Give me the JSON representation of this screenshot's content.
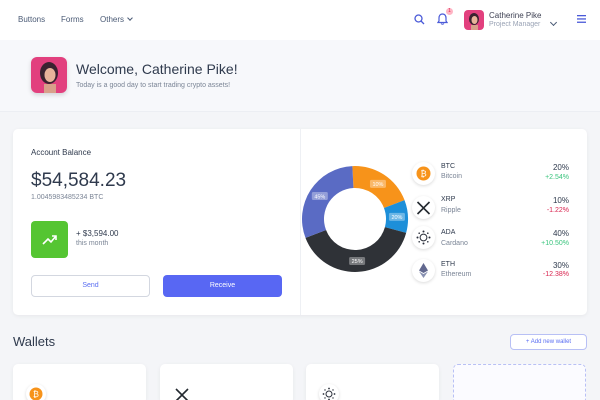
{
  "nav": {
    "links": [
      "Buttons",
      "Forms",
      "Others"
    ],
    "notification_count": "1",
    "user": {
      "name": "Catherine Pike",
      "role": "Project Manager"
    }
  },
  "welcome": {
    "title": "Welcome, Catherine Pike!",
    "subtitle": "Today is a good day to start trading crypto assets!"
  },
  "account": {
    "title": "Account Balance",
    "amount": "$54,584.23",
    "btc": "1.0045983485234 BTC",
    "change_amount": "+ $3,594.00",
    "change_period": "this month",
    "send_label": "Send",
    "receive_label": "Receive"
  },
  "chart_data": {
    "type": "pie",
    "categories": [
      "BTC",
      "XRP",
      "ADA",
      "ETH"
    ],
    "values": [
      20,
      10,
      40,
      30
    ],
    "colors": [
      "#f7931a",
      "#1d8fd9",
      "#2f3237",
      "#5a6bc4"
    ],
    "donut_labels": [
      "10%",
      "20%",
      "25%",
      "45%"
    ]
  },
  "assets": [
    {
      "symbol": "BTC",
      "name": "Bitcoin",
      "percent": "20%",
      "change": "+2.54%",
      "direction": "up",
      "icon": "bitcoin-icon"
    },
    {
      "symbol": "XRP",
      "name": "Ripple",
      "percent": "10%",
      "change": "-1.22%",
      "direction": "down",
      "icon": "xrp-icon"
    },
    {
      "symbol": "ADA",
      "name": "Cardano",
      "percent": "40%",
      "change": "+10.50%",
      "direction": "up",
      "icon": "cardano-icon"
    },
    {
      "symbol": "ETH",
      "name": "Ethereum",
      "percent": "30%",
      "change": "-12.38%",
      "direction": "down",
      "icon": "ethereum-icon"
    }
  ],
  "wallets": {
    "title": "Wallets",
    "add_label": "+ Add new wallet"
  },
  "colors": {
    "accent": "#5867f3",
    "positive": "#3ac47d",
    "negative": "#d92550",
    "trend": "#55c532"
  }
}
